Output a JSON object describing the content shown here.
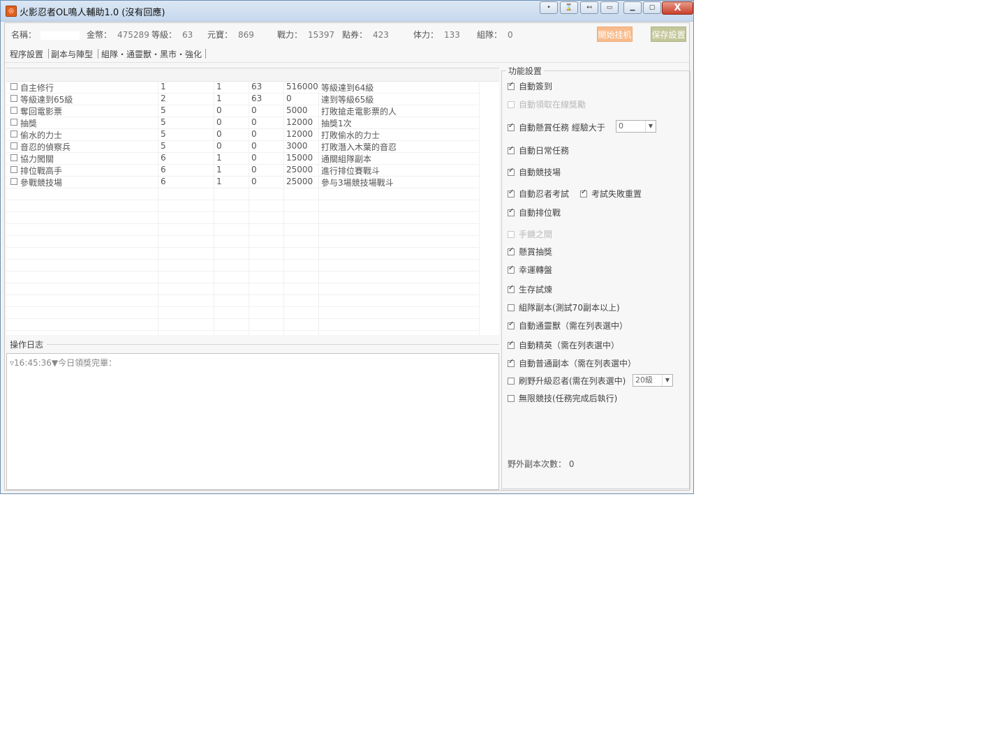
{
  "window": {
    "title": "火影忍者OL鳴人輔助1.0 (沒有回應)",
    "close_label": "X"
  },
  "stats": [
    {
      "label": "名稱：",
      "value": ""
    },
    {
      "label": "金幣：",
      "value": "475289"
    },
    {
      "label": "等級：",
      "value": "63"
    },
    {
      "label": "元寶：",
      "value": "869"
    },
    {
      "label": "戰力：",
      "value": "15397"
    },
    {
      "label": "點券：",
      "value": "423"
    },
    {
      "label": "体力：",
      "value": "133"
    },
    {
      "label": "組隊：",
      "value": "0"
    }
  ],
  "buttons": {
    "start": "開始挂机",
    "save": "保存設置"
  },
  "tabs": [
    "程序設置",
    "副本与陣型",
    "組隊・通靈獸・黑市・強化"
  ],
  "tasks": [
    [
      "自主修行",
      "1",
      "1",
      "63",
      "516000",
      "等級達到64級"
    ],
    [
      "等級達到65級",
      "2",
      "1",
      "63",
      "0",
      "達到等級65級"
    ],
    [
      "奪回電影票",
      "5",
      "0",
      "0",
      "5000",
      "打敗搶走電影票的人"
    ],
    [
      "抽獎",
      "5",
      "0",
      "0",
      "12000",
      "抽獎1次"
    ],
    [
      "偷水的力士",
      "5",
      "0",
      "0",
      "12000",
      "打敗偷水的力士"
    ],
    [
      "音忍的偵察兵",
      "5",
      "0",
      "0",
      "3000",
      "打敗潛入木葉的音忍"
    ],
    [
      "協力闖關",
      "6",
      "1",
      "0",
      "15000",
      "通關組隊副本"
    ],
    [
      "排位戰高手",
      "6",
      "1",
      "0",
      "25000",
      "進行排位賽戰斗"
    ],
    [
      "參戰競技場",
      "6",
      "1",
      "0",
      "25000",
      "參与3場競技場戰斗"
    ]
  ],
  "log": {
    "label": "操作日志",
    "lines": [
      "▿16:45:36▼今日領獎完畢："
    ]
  },
  "settings": {
    "legend": "功能設置",
    "options": {
      "auto_sign": "自動簽到",
      "online_reward": "自動領取在線獎勵",
      "bounty_task": "自動懸賞任務 經驗大于",
      "daily_task": "自動日常任務",
      "arena": "自動競技場",
      "ninja_exam": "自動忍者考試",
      "exam_reset": "考試失敗重置",
      "ranked": "自動排位戰",
      "hand_mirror": "手鏡之間",
      "bounty_lottery": "懸賞抽獎",
      "lucky_wheel": "幸運轉盤",
      "survival": "生存試煉",
      "team_dungeon": "組隊副本(測試70副本以上)",
      "summon_beast": "自動通靈獸（需在列表選中）",
      "elite": "自動精英（需在列表選中）",
      "normal_dungeon": "自動普通副本（需在列表選中）",
      "wild_level": "刷野升級忍者(需在列表選中)",
      "infinite_arena": "無限競技(任務完成后執行)"
    },
    "bounty_exp_value": "0",
    "wild_level_value": "20級",
    "wild_count_label": "野外副本次數：",
    "wild_count_value": "0"
  }
}
